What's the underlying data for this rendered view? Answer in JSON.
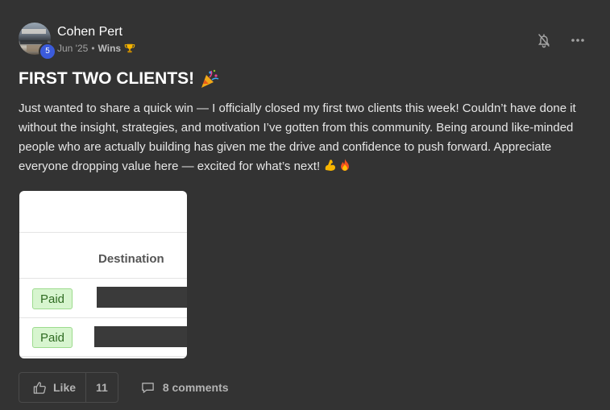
{
  "post": {
    "author": "Cohen Pert",
    "level": "5",
    "date": "Jun '25",
    "separator": "•",
    "category": "Wins",
    "title": "FIRST TWO CLIENTS!",
    "body": "Just wanted to share a quick win — I officially closed my first two clients this week! Couldn’t have done it without the insight, strategies, and motivation I’ve gotten from this community. Being around like-minded people who are actually building has given me the drive and confidence to push forward. Appreciate everyone dropping value here — excited for what’s next!",
    "title_emoji": "party-popper-icon",
    "body_emojis": [
      "flexed-biceps-icon",
      "fire-icon"
    ]
  },
  "attachment": {
    "column_header": "Destination",
    "rows": [
      {
        "status": "Paid"
      },
      {
        "status": "Paid"
      }
    ]
  },
  "footer": {
    "like_label": "Like",
    "like_count": "11",
    "comments_label": "8 comments"
  },
  "colors": {
    "background": "#333333",
    "level_badge": "#3b5bdb",
    "paid_badge": "#d7f5cf"
  }
}
